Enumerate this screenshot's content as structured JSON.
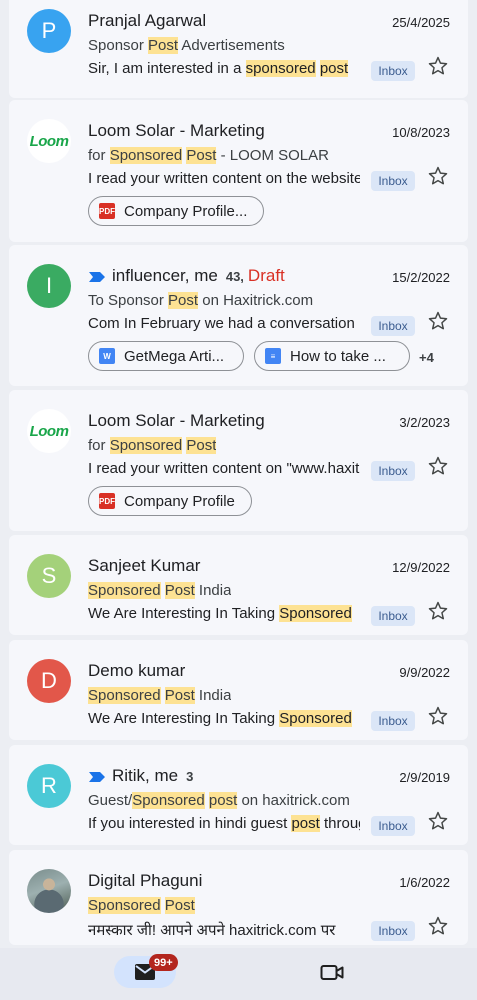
{
  "emails": [
    {
      "avatar_letter": "P",
      "avatar_color": "#38a3f0",
      "sender": "Pranjal Agarwal",
      "date": "25/4/2025",
      "subject": [
        "Sponsor ",
        {
          "h": "Post"
        },
        " Advertisements"
      ],
      "snippet": [
        "Sir, I am interested in a ",
        {
          "h": "sponsored"
        },
        " ",
        {
          "h": "post"
        }
      ],
      "label": "Inbox"
    },
    {
      "avatar_type": "loom",
      "avatar_text": "Loom",
      "sender": "Loom Solar - Marketing",
      "date": "10/8/2023",
      "subject": [
        "for ",
        {
          "h": "Sponsored"
        },
        " ",
        {
          "h": "Post"
        },
        " - LOOM SOLAR"
      ],
      "snippet": [
        "I read your written content on the website"
      ],
      "label": "Inbox",
      "attachments": [
        {
          "type": "pdf",
          "name": "Company Profile..."
        }
      ]
    },
    {
      "avatar_letter": "I",
      "avatar_color": "#3aab62",
      "sender": "influencer, me",
      "count": "43,",
      "draft": "Draft",
      "date": "15/2/2022",
      "subject": [
        "To Sponsor ",
        {
          "h": "Post"
        },
        " on Haxitrick.com"
      ],
      "snippet": [
        "Com In February we had a conversation"
      ],
      "label": "Inbox",
      "attachments": [
        {
          "type": "word",
          "name": "GetMega Arti..."
        },
        {
          "type": "gdoc",
          "name": "How to take ..."
        }
      ],
      "more": "+4"
    },
    {
      "avatar_type": "loom",
      "avatar_text": "Loom",
      "sender": "Loom Solar - Marketing",
      "date": "3/2/2023",
      "subject": [
        "for ",
        {
          "h": "Sponsored"
        },
        " ",
        {
          "h": "Post"
        }
      ],
      "snippet": [
        "I read your written content on \"www.haxitrick.com\""
      ],
      "label": "Inbox",
      "attachments": [
        {
          "type": "pdf",
          "name": "Company Profile"
        }
      ]
    },
    {
      "avatar_letter": "S",
      "avatar_color": "#a4d17a",
      "sender": "Sanjeet Kumar",
      "date": "12/9/2022",
      "subject": [
        {
          "h": "Sponsored"
        },
        " ",
        {
          "h": "Post"
        },
        " India"
      ],
      "snippet": [
        "We Are Interesting In Taking ",
        {
          "h": "Sponsored"
        }
      ],
      "label": "Inbox"
    },
    {
      "avatar_letter": "D",
      "avatar_color": "#e2574a",
      "sender": "Demo kumar",
      "date": "9/9/2022",
      "subject": [
        {
          "h": "Sponsored"
        },
        " ",
        {
          "h": "Post"
        },
        " India"
      ],
      "snippet": [
        "We Are Interesting In Taking ",
        {
          "h": "Sponsored"
        }
      ],
      "label": "Inbox"
    },
    {
      "avatar_letter": "R",
      "avatar_color": "#4bc9d6",
      "sender": "Ritik, me",
      "count": "3",
      "date": "2/9/2019",
      "subject": [
        "Guest/",
        {
          "h": "Sponsored"
        },
        " ",
        {
          "h": "post"
        },
        " on haxitrick.com"
      ],
      "snippet": [
        "If you interested in hindi guest ",
        {
          "h": "post"
        },
        " through"
      ],
      "label": "Inbox"
    },
    {
      "avatar_type": "photo",
      "sender": "Digital Phaguni",
      "date": "1/6/2022",
      "subject": [
        {
          "h": "Sponsored"
        },
        " ",
        {
          "h": "Post"
        }
      ],
      "snippet": [
        "नमस्कार जी! आपने अपने haxitrick.com पर"
      ],
      "label": "Inbox"
    }
  ],
  "bottom_nav": {
    "mail_icon": "mail-icon",
    "badge": "99+",
    "video_icon": "video-icon"
  }
}
